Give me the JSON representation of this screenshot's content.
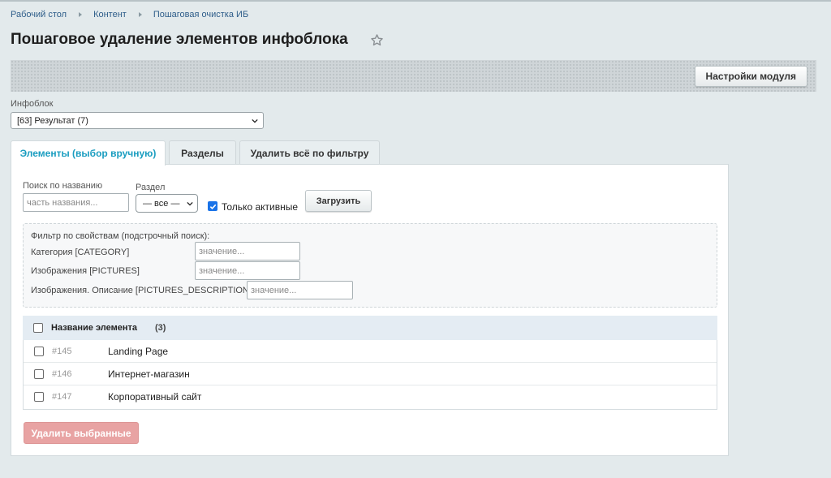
{
  "breadcrumb": [
    "Рабочий стол",
    "Контент",
    "Пошаговая очистка ИБ"
  ],
  "page_title": "Пошаговое удаление элементов инфоблока",
  "toolbar": {
    "settings_label": "Настройки модуля"
  },
  "iblock": {
    "label": "Инфоблок",
    "selected": "[63] Результат (7)"
  },
  "tabs": [
    {
      "label": "Элементы (выбор вручную)",
      "active": true
    },
    {
      "label": "Разделы",
      "active": false
    },
    {
      "label": "Удалить всё по фильтру",
      "active": false
    }
  ],
  "filter": {
    "search_label": "Поиск по названию",
    "search_placeholder": "часть названия...",
    "section_label": "Раздел",
    "section_selected": "— все —",
    "active_only_label": "Только активные",
    "active_only_checked": true,
    "load_label": "Загрузить"
  },
  "props": {
    "title": "Фильтр по свойствам (подстрочный поиск):",
    "items": [
      {
        "label": "Категория [CATEGORY]",
        "placeholder": "значение..."
      },
      {
        "label": "Изображения [PICTURES]",
        "placeholder": "значение..."
      },
      {
        "label": "Изображения. Описание [PICTURES_DESCRIPTION]",
        "placeholder": "значение..."
      }
    ]
  },
  "list": {
    "header": "Название элемента",
    "count": "(3)",
    "rows": [
      {
        "id": "#145",
        "name": "Landing Page"
      },
      {
        "id": "#146",
        "name": "Интернет-магазин"
      },
      {
        "id": "#147",
        "name": "Корпоративный сайт"
      }
    ]
  },
  "delete_label": "Удалить выбранные",
  "colors": {
    "accent": "#1a9dc0",
    "link": "#2f5e8a",
    "danger_disabled": "#e8a3a3",
    "checkbox": "#1a73e8"
  }
}
